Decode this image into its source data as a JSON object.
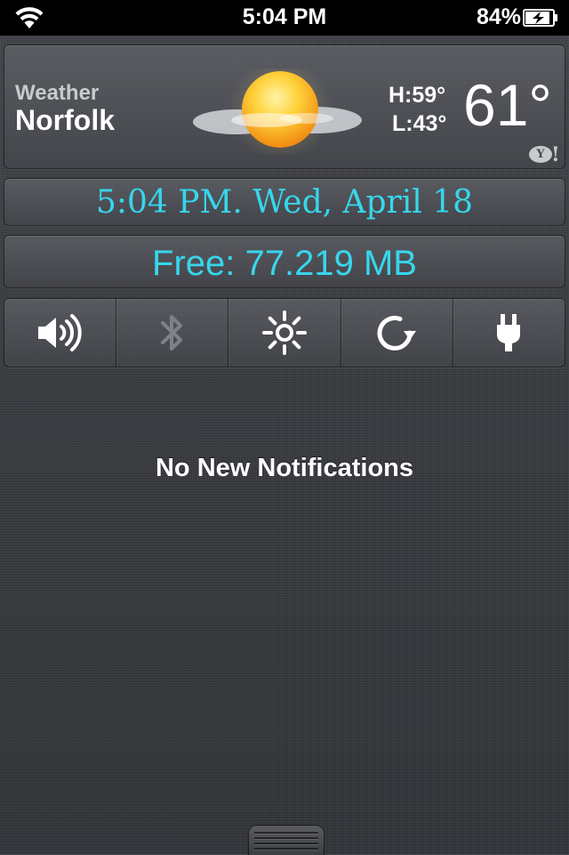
{
  "status_bar": {
    "time": "5:04 PM",
    "battery_percent": "84%",
    "wifi_icon": "wifi-icon",
    "battery_icon": "battery-charging-icon"
  },
  "weather": {
    "label": "Weather",
    "city": "Norfolk",
    "high": "H:59°",
    "low": "L:43°",
    "temperature": "61°",
    "condition_icon": "sun-cloud-icon",
    "provider_icon": "yahoo-logo"
  },
  "date_widget": {
    "text": "5:04 PM. Wed, April 18",
    "color": "#37d6ec"
  },
  "memory_widget": {
    "text": "Free: 77.219 MB",
    "color": "#37d6ec"
  },
  "toggles": [
    {
      "name": "volume",
      "icon": "speaker-icon",
      "enabled": true
    },
    {
      "name": "bluetooth",
      "icon": "bluetooth-icon",
      "enabled": false
    },
    {
      "name": "brightness",
      "icon": "brightness-icon",
      "enabled": true
    },
    {
      "name": "rotation",
      "icon": "rotation-icon",
      "enabled": true
    },
    {
      "name": "power",
      "icon": "plug-icon",
      "enabled": true
    }
  ],
  "notifications": {
    "empty_message": "No New Notifications"
  }
}
